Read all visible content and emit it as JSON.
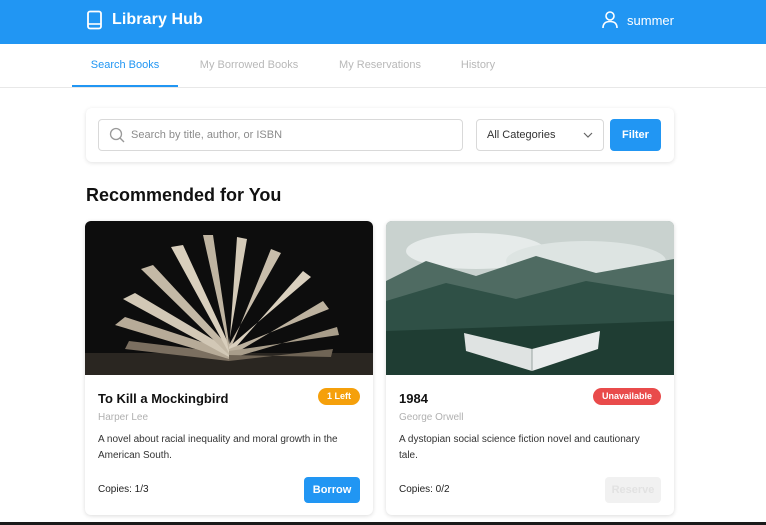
{
  "header": {
    "title": "Library Hub",
    "user": "summer"
  },
  "tabs": [
    {
      "label": "Search Books",
      "active": true
    },
    {
      "label": "My Borrowed Books",
      "active": false
    },
    {
      "label": "My Reservations",
      "active": false
    },
    {
      "label": "History",
      "active": false
    }
  ],
  "search": {
    "placeholder": "Search by title, author, or ISBN",
    "value": "",
    "category": "All Categories",
    "filter_label": "Filter"
  },
  "section": {
    "title": "Recommended for You"
  },
  "books": [
    {
      "title": "To Kill a Mockingbird",
      "author": "Harper Lee",
      "description": "A novel about racial inequality and moral growth in the American South.",
      "copies": "Copies: 1/3",
      "badge": "1 Left",
      "badge_color": "#f5a00b",
      "button": "Borrow"
    },
    {
      "title": "1984",
      "author": "George Orwell",
      "description": "A dystopian social science fiction novel and cautionary tale.",
      "copies": "Copies: 0/2",
      "badge": "Unavailable",
      "badge_color": "#e94b4b",
      "button": "Reserve"
    }
  ],
  "colors": {
    "accent": "#2196f3"
  }
}
